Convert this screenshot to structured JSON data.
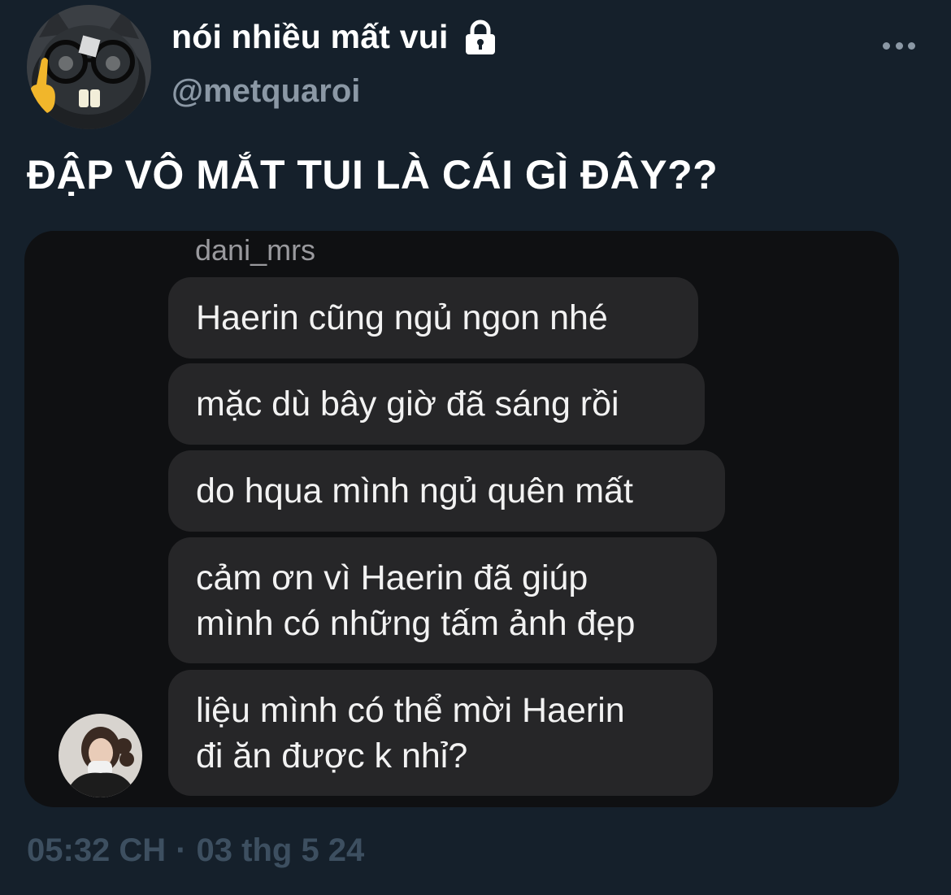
{
  "author": {
    "display_name": "nói nhiều mất vui",
    "handle": "@metquaroi",
    "avatar_icon": "cat-with-glasses-avatar",
    "verified_icon": "lock-icon"
  },
  "tweet": {
    "text": "ĐẬP VÔ MẮT TUI LÀ CÁI GÌ ĐÂY??",
    "time": "05:32 CH",
    "separator": "·",
    "date": "03 thg 5 24"
  },
  "chat": {
    "sender": "dani_mrs",
    "messages": [
      {
        "lines": [
          "Haerin cũng ngủ ngon nhé"
        ]
      },
      {
        "lines": [
          "mặc dù bây giờ đã sáng rồi"
        ]
      },
      {
        "lines": [
          "do hqua mình ngủ quên mất"
        ]
      },
      {
        "lines": [
          "cảm ơn vì Haerin đã giúp",
          "mình có những tấm ảnh đẹp"
        ]
      },
      {
        "lines": [
          "liệu mình có thể mời Haerin",
          "đi ăn được k nhỉ?"
        ]
      }
    ]
  },
  "colors": {
    "background": "#15202b",
    "secondary_text": "#8b98a5",
    "timestamp": "#3d4f60",
    "bubble": "#262628",
    "media_bg": "#0f1012"
  }
}
